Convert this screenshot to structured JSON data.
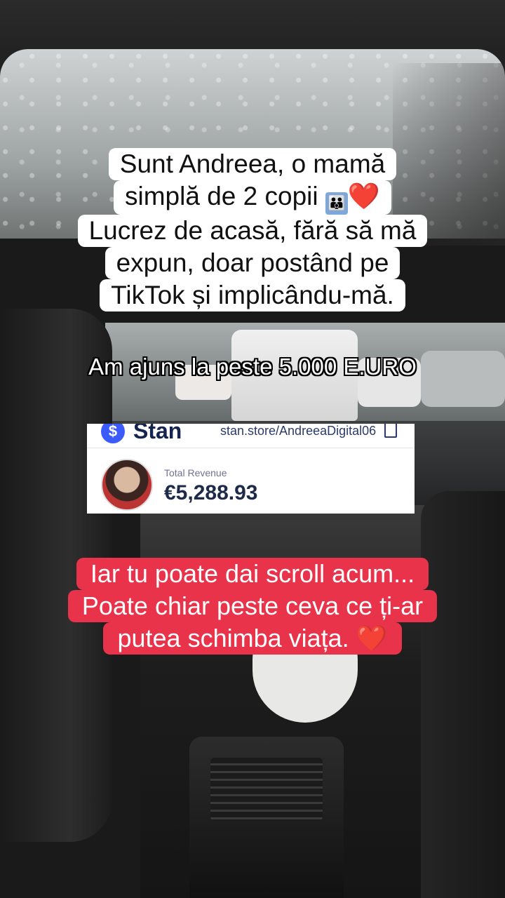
{
  "captions": {
    "intro_lines": [
      "Sunt Andreea, o mamă",
      "simplă de 2 copii",
      "Lucrez de acasă, fără să mă",
      "expun, doar postând pe",
      "TikTok și implicându-mă."
    ],
    "intro_emoji_family": "👪",
    "heart": "❤️",
    "earnings_text": "Am ajuns la peste 5.000 E.URO",
    "closing_lines": [
      "Iar tu poate dai scroll acum...",
      "Poate chiar peste ceva ce ți-ar",
      "putea schimba viața."
    ]
  },
  "stan_card": {
    "logo_symbol": "$",
    "brand": "Stan",
    "url": "stan.store/AndreeaDigital06",
    "revenue_label": "Total Revenue",
    "revenue_value": "€5,288.93"
  },
  "colors": {
    "caption_red": "#e8334a",
    "stan_blue": "#3b5bfd"
  }
}
